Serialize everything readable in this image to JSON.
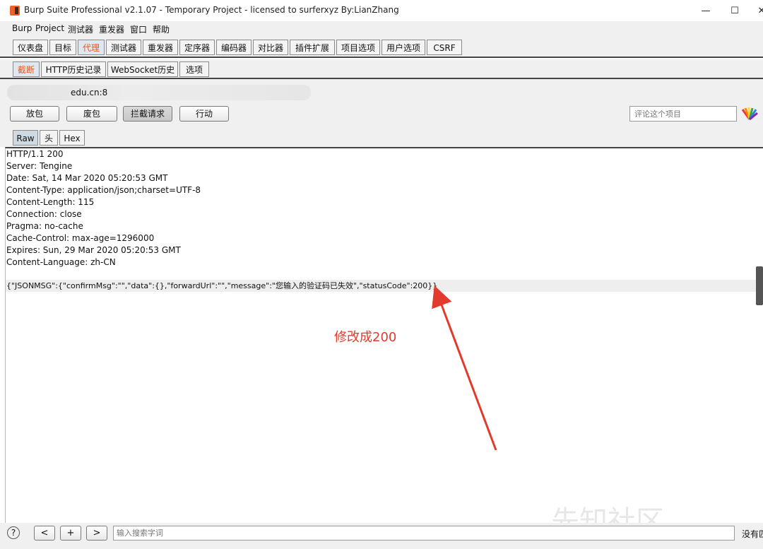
{
  "window": {
    "title": "Burp Suite Professional v2.1.07 - Temporary Project - licensed to surferxyz By:LianZhang",
    "minimize": "—",
    "maximize": "☐",
    "close": "✕"
  },
  "menubar": [
    "Burp",
    "Project",
    "测试器",
    "重发器",
    "窗口",
    "帮助"
  ],
  "main_tabs": [
    {
      "label": "仪表盘",
      "active": false
    },
    {
      "label": "目标",
      "active": false
    },
    {
      "label": "代理",
      "active": true
    },
    {
      "label": "测试器",
      "active": false
    },
    {
      "label": "重发器",
      "active": false
    },
    {
      "label": "定序器",
      "active": false
    },
    {
      "label": "编码器",
      "active": false
    },
    {
      "label": "对比器",
      "active": false
    },
    {
      "label": "插件扩展",
      "active": false
    },
    {
      "label": "项目选项",
      "active": false
    },
    {
      "label": "用户选项",
      "active": false
    },
    {
      "label": "CSRF",
      "active": false
    }
  ],
  "proxy_tabs": [
    {
      "label": "截断",
      "active": true
    },
    {
      "label": "HTTP历史记录",
      "active": false
    },
    {
      "label": "WebSocket历史",
      "active": false
    },
    {
      "label": "选项",
      "active": false
    }
  ],
  "intercept": {
    "host": "edu.cn:8",
    "buttons": {
      "forward": "放包",
      "drop": "废包",
      "intercept": "拦截请求",
      "action": "行动"
    },
    "comment_placeholder": "评论这个项目"
  },
  "view_tabs": [
    {
      "label": "Raw",
      "active": true
    },
    {
      "label": "头",
      "active": false
    },
    {
      "label": "Hex",
      "active": false
    }
  ],
  "response_lines": [
    "HTTP/1.1 200",
    "Server: Tengine",
    "Date: Sat, 14 Mar 2020 05:20:53 GMT",
    "Content-Type: application/json;charset=UTF-8",
    "Content-Length: 115",
    "Connection: close",
    "Pragma: no-cache",
    "Cache-Control: max-age=1296000",
    "Expires: Sun, 29 Mar 2020 05:20:53 GMT",
    "Content-Language: zh-CN"
  ],
  "json_body": "{\"JSONMSG\":{\"confirmMsg\":\"\",\"data\":{},\"forwardUrl\":\"\",\"message\":\"您输入的验证码已失效\",\"statusCode\":200}}",
  "annotation": {
    "text": "修改成200",
    "color": "#e23b2e"
  },
  "bottom": {
    "help": "?",
    "prev": "<",
    "add": "+",
    "next": ">",
    "search_placeholder": "输入搜索字词",
    "match_text": "没有匹"
  },
  "watermark": "先知社区",
  "colors": {
    "active_tab_text": "#e85a1e",
    "annotation_red": "#e23b2e"
  }
}
